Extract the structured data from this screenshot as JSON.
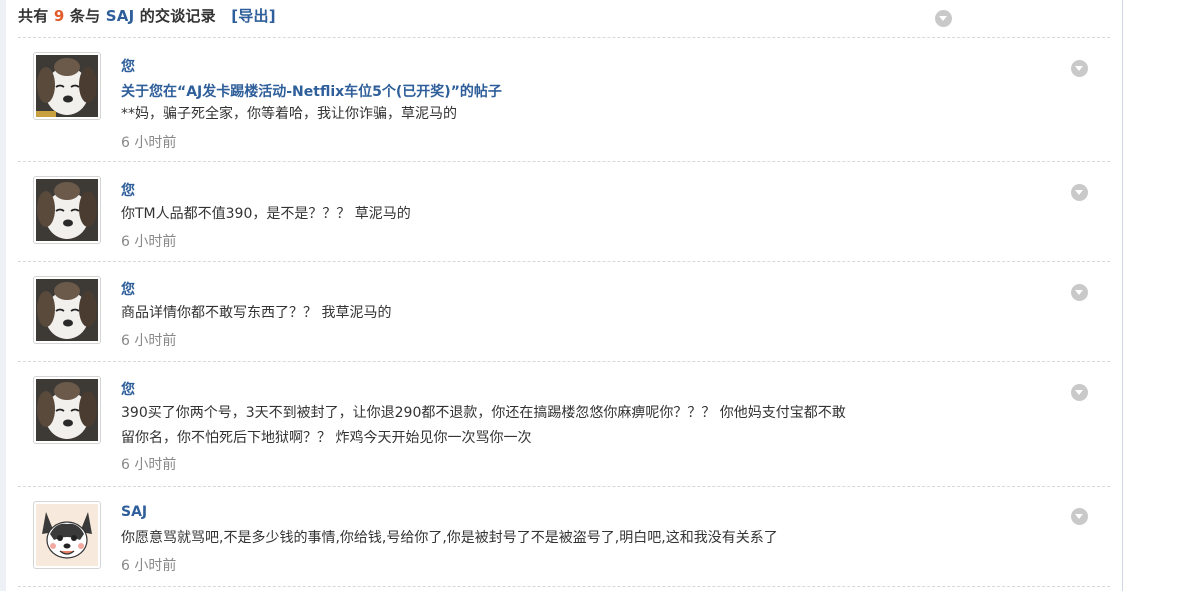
{
  "header": {
    "prefix": "共有",
    "count": "9",
    "middle": "条与",
    "partner": "SAJ",
    "suffix": "的交谈记录",
    "export_label": "[导出]"
  },
  "messages": [
    {
      "sender": "您",
      "subject": "关于您在“AJ发卡踢楼活动-Netflix车位5个(已开奖)”的帖子",
      "lines": [
        "**妈，骗子死全家，你等着哈，我让你诈骗，草泥马的"
      ],
      "time": "6 小时前",
      "avatar": "dog-avatar"
    },
    {
      "sender": "您",
      "lines": [
        "你TM人品都不值390，是不是？？？ 草泥马的"
      ],
      "time": "6 小时前",
      "avatar": "dog-avatar"
    },
    {
      "sender": "您",
      "lines": [
        "商品详情你都不敢写东西了？？ 我草泥马的"
      ],
      "time": "6 小时前",
      "avatar": "dog-avatar"
    },
    {
      "sender": "您",
      "lines": [
        "390买了你两个号，3天不到被封了，让你退290都不退款，你还在搞踢楼忽悠你麻痹呢你？？？ 你他妈支付宝都不敢",
        "留你名，你不怕死后下地狱啊？？ 炸鸡今天开始见你一次骂你一次"
      ],
      "time": "6 小时前",
      "avatar": "dog-avatar"
    },
    {
      "sender": "SAJ",
      "lines": [
        "你愿意骂就骂吧,不是多少钱的事情,你给钱,号给你了,你是被封号了不是被盗号了,明白吧,这和我没有关系了"
      ],
      "time": "6 小时前",
      "avatar": "cartoon-dog-avatar"
    }
  ],
  "colors": {
    "link": "#2f5f9a",
    "count": "#e05c2a",
    "time": "#888888",
    "text": "#333333",
    "collapse": "#c9c9c9"
  }
}
